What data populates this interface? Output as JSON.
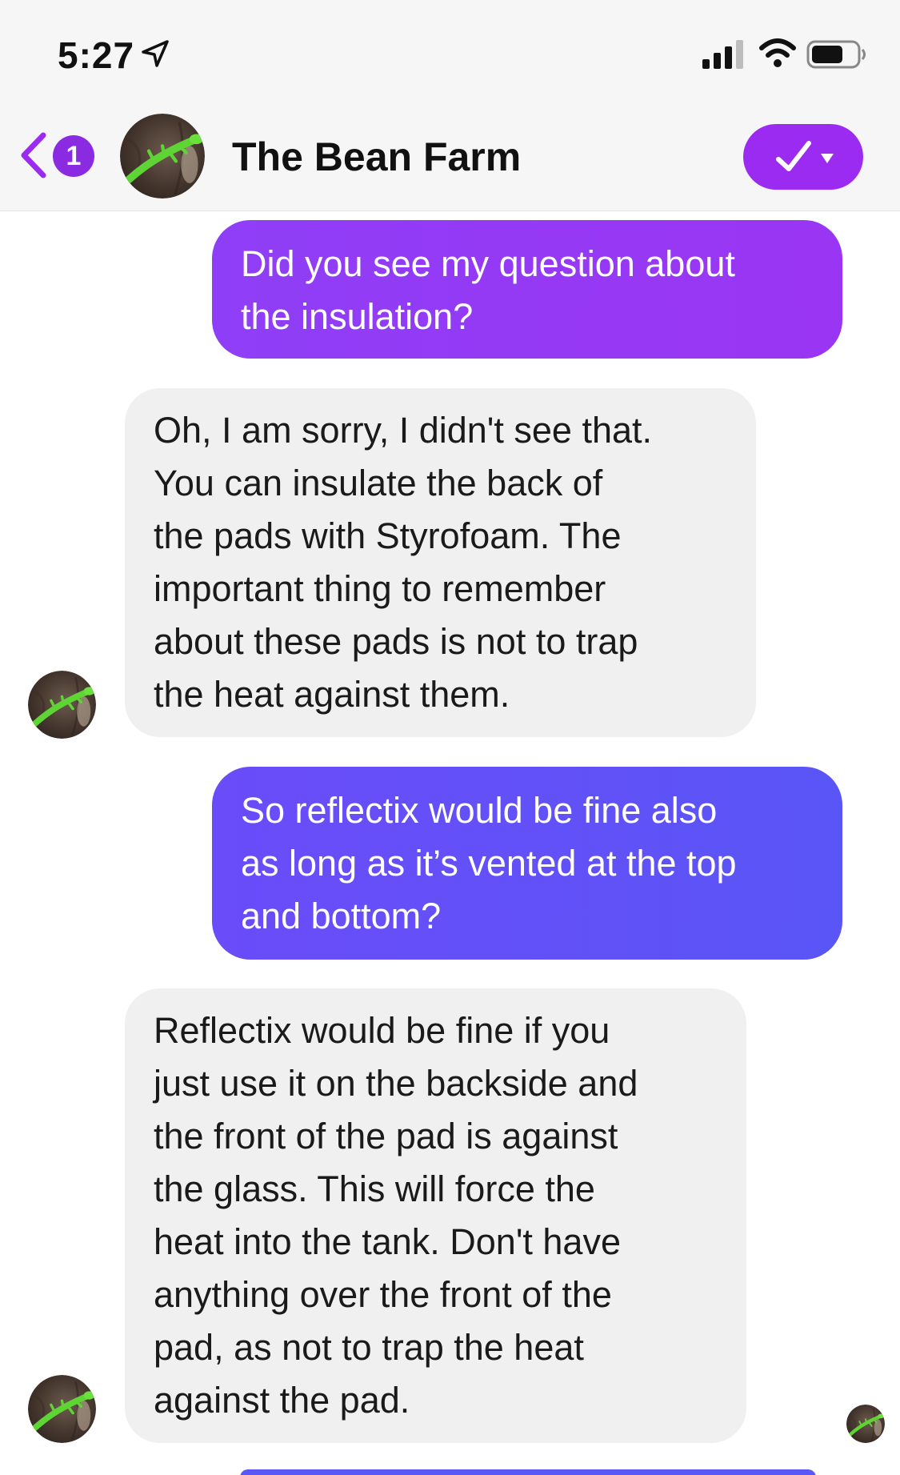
{
  "status_bar": {
    "time": "5:27",
    "icons": [
      "location-arrow-icon",
      "cellular-signal-icon",
      "wifi-icon",
      "battery-icon"
    ]
  },
  "header": {
    "unread_count": "1",
    "contact_name": "The Bean Farm",
    "status_toggle_icon": "checkmark-icon",
    "accent_color": "#9b2bf0"
  },
  "messages": [
    {
      "direction": "outgoing",
      "text": "Did you see my question about\nthe insulation?"
    },
    {
      "direction": "incoming",
      "text": "Oh, I am sorry, I didn't see that.\nYou can insulate the back of\nthe pads with Styrofoam. The\nimportant thing to remember\nabout these pads is not to trap\nthe heat against them."
    },
    {
      "direction": "outgoing",
      "text": "So reflectix would be fine also\nas long as it’s vented at the top\nand bottom?"
    },
    {
      "direction": "incoming",
      "text": "Reflectix would be fine if you\njust use it on the backside and\nthe front of the pad is against\nthe glass. This will force the\nheat into the tank. Don't have\nanything over the front of the\npad, as not to trap the heat\nagainst the pad."
    }
  ],
  "colors": {
    "outgoing_bubble_purple": "#9538f5",
    "outgoing_bubble_blue": "#5f52f7",
    "incoming_bubble": "#f0f0f0",
    "header_background": "#f6f6f6"
  }
}
